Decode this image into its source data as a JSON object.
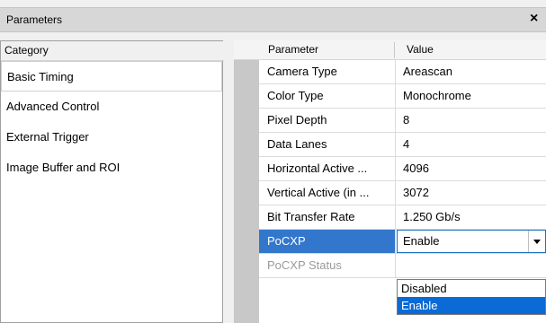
{
  "window": {
    "title": "Parameters",
    "close_label": "×"
  },
  "category_pane": {
    "header": "Category",
    "items": [
      {
        "label": "Basic Timing",
        "selected": true
      },
      {
        "label": "Advanced Control",
        "selected": false
      },
      {
        "label": "External Trigger",
        "selected": false
      },
      {
        "label": "Image Buffer and ROI",
        "selected": false
      }
    ]
  },
  "parameter_grid": {
    "header_parameter": "Parameter",
    "header_value": "Value",
    "rows": [
      {
        "name": "Camera Type",
        "value": "Areascan"
      },
      {
        "name": "Color Type",
        "value": "Monochrome"
      },
      {
        "name": "Pixel Depth",
        "value": "8"
      },
      {
        "name": "Data Lanes",
        "value": "4"
      },
      {
        "name": "Horizontal Active ...",
        "value": "4096"
      },
      {
        "name": "Vertical Active (in ...",
        "value": "3072"
      },
      {
        "name": "Bit Transfer Rate",
        "value": "1.250 Gb/s"
      },
      {
        "name": "PoCXP",
        "value": "Enable"
      },
      {
        "name": "PoCXP Status",
        "value": ""
      }
    ]
  },
  "dropdown": {
    "options": [
      "Disabled",
      "Enable"
    ],
    "selected": "Enable"
  },
  "colors": {
    "highlight": "#3377cc",
    "dropdown_selected": "#0a6ad6",
    "gutter": "#c8c8c8"
  }
}
